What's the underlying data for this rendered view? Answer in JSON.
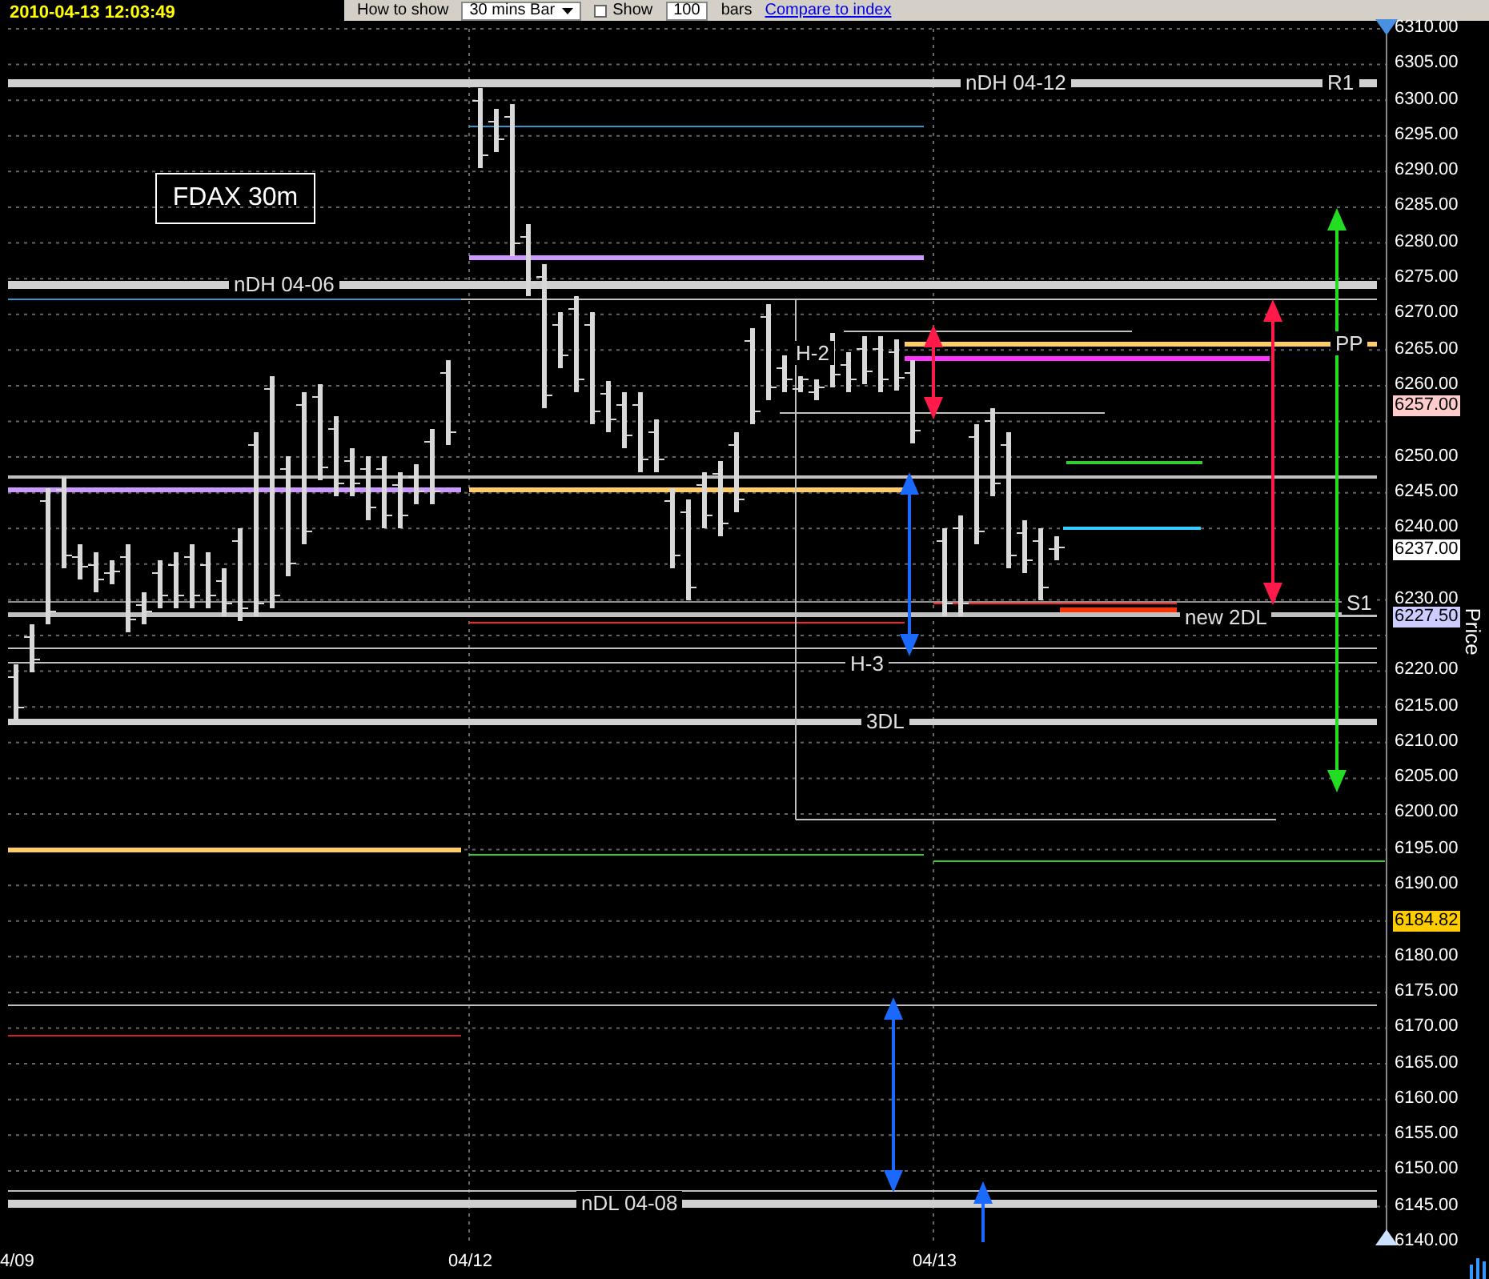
{
  "timestamp": "2010-04-13 12:03:49",
  "toolbar": {
    "how_label": "How to show",
    "bar_type": "30 mins Bar",
    "show_checkbox": {
      "label": "Show",
      "checked": false
    },
    "bar_count": "100",
    "bars_label": "bars",
    "compare_link": "Compare to index"
  },
  "chart": {
    "title": "FDAX 30m",
    "level_labels": [
      "nDH 04-12",
      "R1",
      "nDH 04-06",
      "H-2",
      "PP",
      "S1",
      "new 2DL",
      "H-3",
      "3DL",
      "nDL 04-08"
    ],
    "price_axis": {
      "title": "Price",
      "ticks": [
        "6310.00",
        "6305.00",
        "6300.00",
        "6295.00",
        "6290.00",
        "6285.00",
        "6280.00",
        "6275.00",
        "6270.00",
        "6265.00",
        "6260.00",
        "6250.00",
        "6245.00",
        "6240.00",
        "6230.00",
        "6220.00",
        "6215.00",
        "6210.00",
        "6205.00",
        "6200.00",
        "6195.00",
        "6190.00",
        "6180.00",
        "6175.00",
        "6170.00",
        "6165.00",
        "6160.00",
        "6155.00",
        "6150.00",
        "6145.00",
        "6140.00"
      ]
    },
    "price_tags": [
      {
        "value": "6257.00",
        "color": "#ffcccc"
      },
      {
        "value": "6237.00",
        "color": "#ffffff"
      },
      {
        "value": "6227.50",
        "color": "#ccccff"
      },
      {
        "value": "6184.82",
        "color": "#ffcc00"
      }
    ],
    "date_labels": [
      "4/09",
      "04/12",
      "04/13"
    ]
  }
}
